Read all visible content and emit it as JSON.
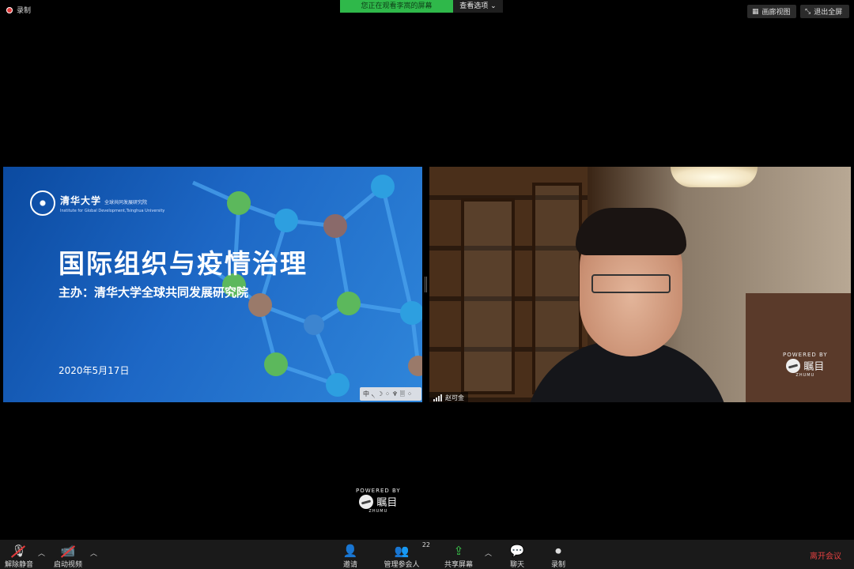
{
  "top_bar": {
    "recording_label": "录制",
    "viewing_banner": "您正在观看李嵩的屏幕",
    "view_options": "查看选项",
    "gallery_view": "画廊视图",
    "exit_fullscreen": "退出全屏"
  },
  "slide": {
    "org_cn": "清华大学",
    "org_sub": "全球共同发展研究院",
    "org_en": "Institute for Global Development,Tsinghua University",
    "title": "国际组织与疫情治理",
    "host": "主办：清华大学全球共同发展研究院",
    "date": "2020年5月17日",
    "ime_bar": "中 ৲ ☽ ⁘ ♆ 🗏 ⁘"
  },
  "video": {
    "participant_name": "赵可金",
    "powered_by": "POWERED BY",
    "brand": "瞩目",
    "brand_en": "ZHUMU"
  },
  "powered": {
    "powered_by": "POWERED BY",
    "brand": "瞩目",
    "brand_en": "ZHUMU"
  },
  "toolbar": {
    "unmute": "解除静音",
    "start_video": "启动视频",
    "invite": "邀请",
    "manage_participants": "管理参会人",
    "participant_count": "22",
    "share_screen": "共享屏幕",
    "chat": "聊天",
    "record": "录制",
    "leave": "离开会议"
  },
  "colors": {
    "banner_green": "#2fb84a",
    "slide_blue": "#1d67c5",
    "leave_red": "#e24040"
  }
}
